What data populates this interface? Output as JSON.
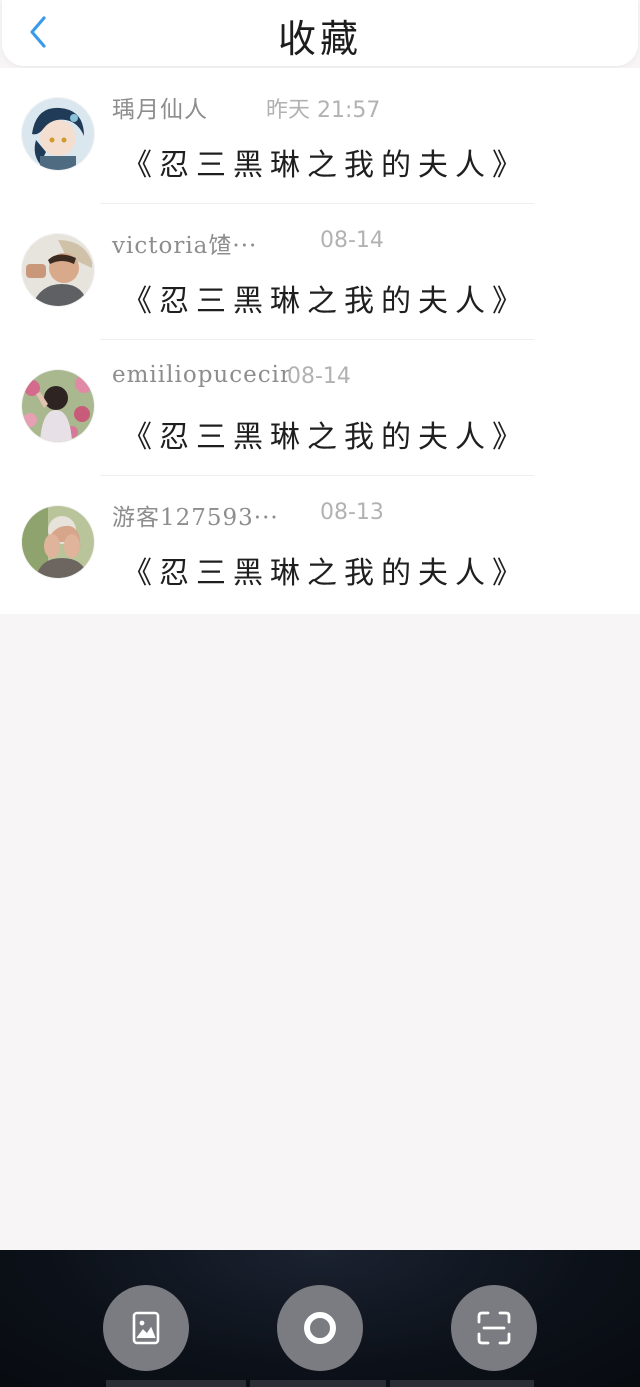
{
  "header": {
    "title": "收藏",
    "back_icon": "chevron-left-icon",
    "accent_color": "#3b9be8"
  },
  "favorites": [
    {
      "user": "瑀月仙人",
      "time": "昨天 21:57",
      "work": "《忍三黑琳之我的夫人》",
      "avatar": "anime-character-avatar"
    },
    {
      "user": "victoria馇···",
      "time": "08-14",
      "work": "《忍三黑琳之我的夫人》",
      "avatar": "person-with-hat-avatar"
    },
    {
      "user": "emiiliopucecir",
      "time": "08-14",
      "work": "《忍三黑琳之我的夫人》",
      "avatar": "person-in-flowers-avatar"
    },
    {
      "user": "游客127593···",
      "time": "08-13",
      "work": "《忍三黑琳之我的夫人》",
      "avatar": "person-covering-face-avatar"
    }
  ],
  "bottom_bar": {
    "buttons": [
      {
        "icon": "gallery-icon"
      },
      {
        "icon": "record-icon"
      },
      {
        "icon": "scan-icon"
      }
    ]
  }
}
